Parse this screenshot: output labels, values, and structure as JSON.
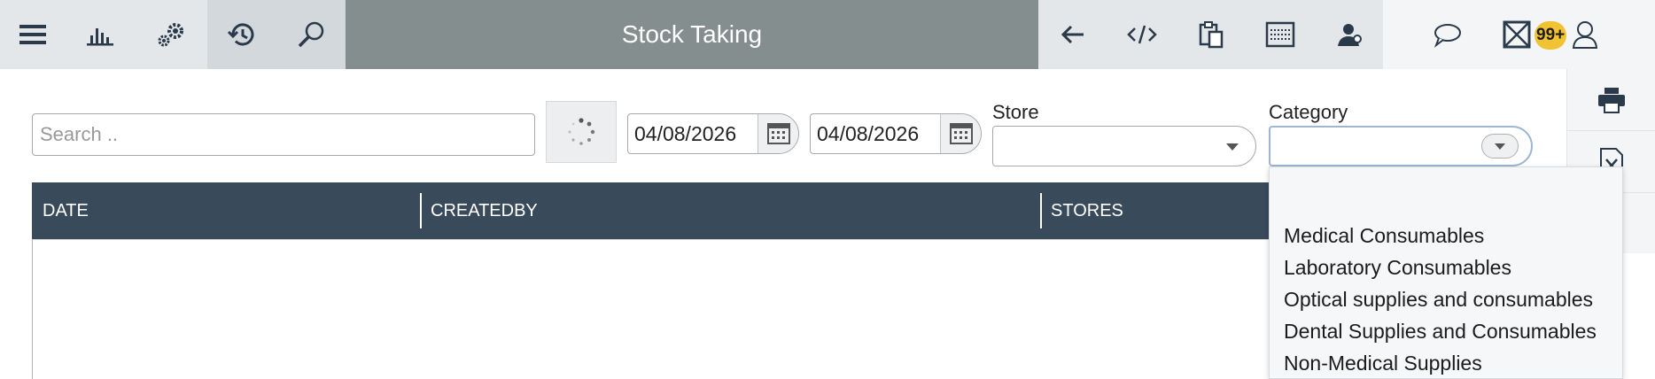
{
  "window": {
    "title": "Stock Taking"
  },
  "toolbar_left": [
    {
      "name": "menu-icon",
      "active": false
    },
    {
      "name": "bar-chart-icon",
      "active": false
    },
    {
      "name": "gears-icon",
      "active": false
    },
    {
      "name": "history-icon",
      "active": true
    },
    {
      "name": "search-icon",
      "active": true
    }
  ],
  "toolbar_right": [
    {
      "name": "back-arrow-icon"
    },
    {
      "name": "code-icon"
    },
    {
      "name": "clipboard-icon"
    },
    {
      "name": "keyboard-icon"
    },
    {
      "name": "user-support-icon"
    }
  ],
  "notifications": {
    "badge": "99+"
  },
  "filters": {
    "search_placeholder": "Search ..",
    "search_value": "",
    "date_from": "04/08/2026",
    "date_to": "04/08/2026",
    "store_label": "Store",
    "store_value": "",
    "category_label": "Category",
    "category_value": ""
  },
  "grid": {
    "columns": [
      "DATE",
      "CREATEDBY",
      "STORES"
    ],
    "rows": []
  },
  "category_dropdown": {
    "options": [
      "",
      "Medical Consumables",
      "Laboratory Consumables",
      "Optical supplies and consumables",
      "Dental Supplies and Consumables",
      "Non-Medical Supplies"
    ]
  },
  "side_actions": [
    {
      "name": "print-icon"
    },
    {
      "name": "excel-export-icon"
    }
  ],
  "colors": {
    "title_bar": "#858e8f",
    "toolbar_bg": "#e4e7ea",
    "grid_header": "#394a5b",
    "badge": "#f1c232"
  }
}
